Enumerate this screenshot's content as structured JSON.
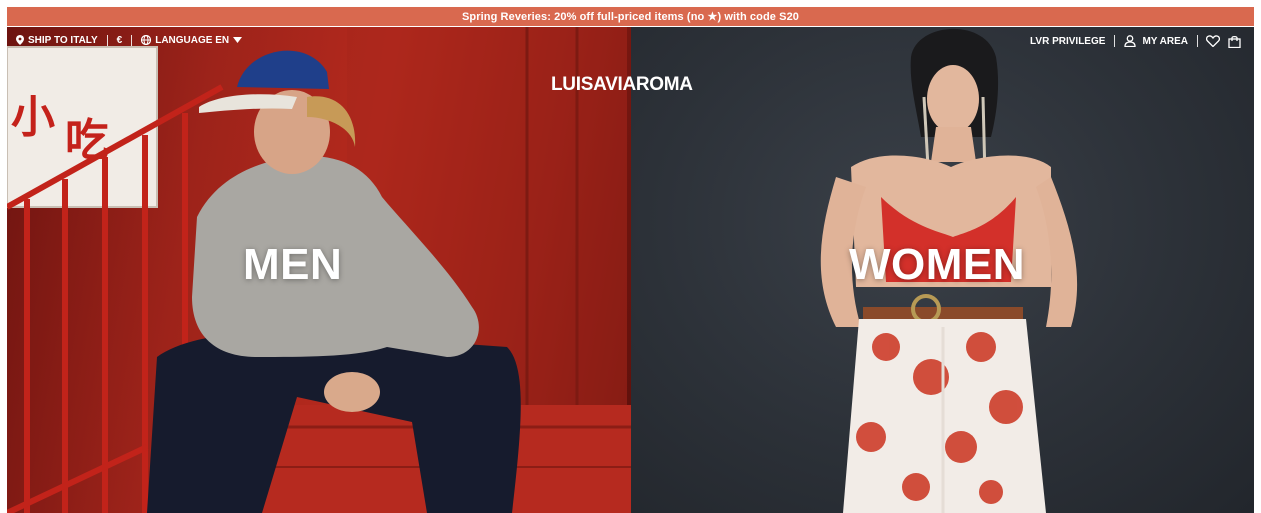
{
  "promo": {
    "text": "Spring Reveries: 20% off full-priced items (no ★) with code S20",
    "bg_color": "#d9694f"
  },
  "nav": {
    "ship_to": {
      "label": "SHIP TO ITALY",
      "icon": "location-pin-icon"
    },
    "currency": "€",
    "language": {
      "label": "LANGUAGE EN",
      "icon": "globe-icon",
      "caret": "chevron-down-icon"
    },
    "privilege": "LVR PRIVILEGE",
    "my_area": {
      "label": "MY AREA",
      "icon": "user-icon"
    },
    "wishlist_icon": "heart-icon",
    "bag_icon": "shopping-bag-icon"
  },
  "logo": "LUISAVIAROMA",
  "hero": {
    "men": {
      "title": "MEN",
      "bg_color": "#9d231a"
    },
    "women": {
      "title": "WOMEN",
      "bg_color": "#2c3138"
    }
  }
}
